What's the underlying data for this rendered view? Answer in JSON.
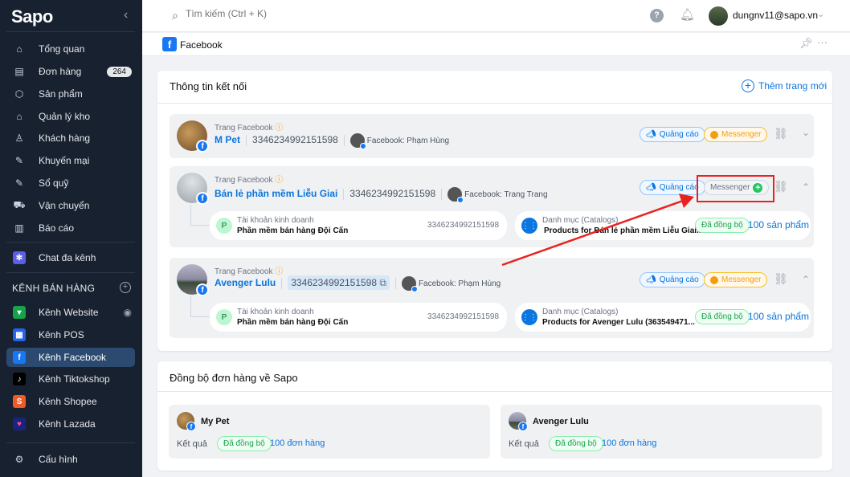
{
  "sidebar": {
    "logo": "Sapo",
    "badge": "264",
    "items": [
      "Tổng quan",
      "Đơn hàng",
      "Sản phẩm",
      "Quản lý kho",
      "Khách hàng",
      "Khuyến mại",
      "Sổ quỹ",
      "Vận chuyển",
      "Báo cáo"
    ],
    "chat": "Chat đa kênh",
    "section": "KÊNH BÁN HÀNG",
    "channels": [
      "Kênh Website",
      "Kênh POS",
      "Kênh Facebook",
      "Kênh Tiktokshop",
      "Kênh Shopee",
      "Kênh Lazada"
    ],
    "settings": "Cấu hình"
  },
  "topbar": {
    "search_placeholder": "Tìm kiếm (Ctrl + K)",
    "user": "dungnv11@sapo.vn"
  },
  "subbar": {
    "title": "Facebook"
  },
  "connections": {
    "title": "Thông tin kết nối",
    "add": "Thêm trang mới",
    "type_label": "Trang Facebook",
    "ads": "Quảng cáo",
    "messenger": "Messenger",
    "biz_label": "Tài khoản kinh doanh",
    "catalog_label": "Danh mục (Catalogs)",
    "synced": "Đã đồng bộ",
    "pages": [
      {
        "name": "M Pet",
        "id": "3346234992151598",
        "owner": "Facebook: Phạm Hùng"
      },
      {
        "name": "Bán lẻ phần mềm Liễu Giai",
        "id": "3346234992151598",
        "owner": "Facebook: Trang Trang",
        "biz": "Phần mềm bán hàng Đội Cấn",
        "biz_id": "3346234992151598",
        "catalog": "Products for Bán lẻ phần mềm Liễu Giai...",
        "products": "100 sản phẩm"
      },
      {
        "name": "Avenger Lulu",
        "id": "3346234992151598",
        "owner": "Facebook: Phạm Hùng",
        "biz": "Phần mềm bán hàng Đội Cấn",
        "biz_id": "3346234992151598",
        "catalog": "Products for Avenger Lulu (363549471...",
        "products": "100 sản phẩm"
      }
    ]
  },
  "sync": {
    "title": "Đồng bộ đơn hàng về Sapo",
    "result_label": "Kết quả",
    "synced": "Đã đồng bộ",
    "pages": [
      {
        "name": "My Pet",
        "orders": "100 đơn hàng"
      },
      {
        "name": "Avenger Lulu",
        "orders": "100 đơn hàng"
      }
    ]
  },
  "colors": {
    "accent": "#0b75e0",
    "sidebar": "#182130",
    "annotation": "#e8231f"
  }
}
